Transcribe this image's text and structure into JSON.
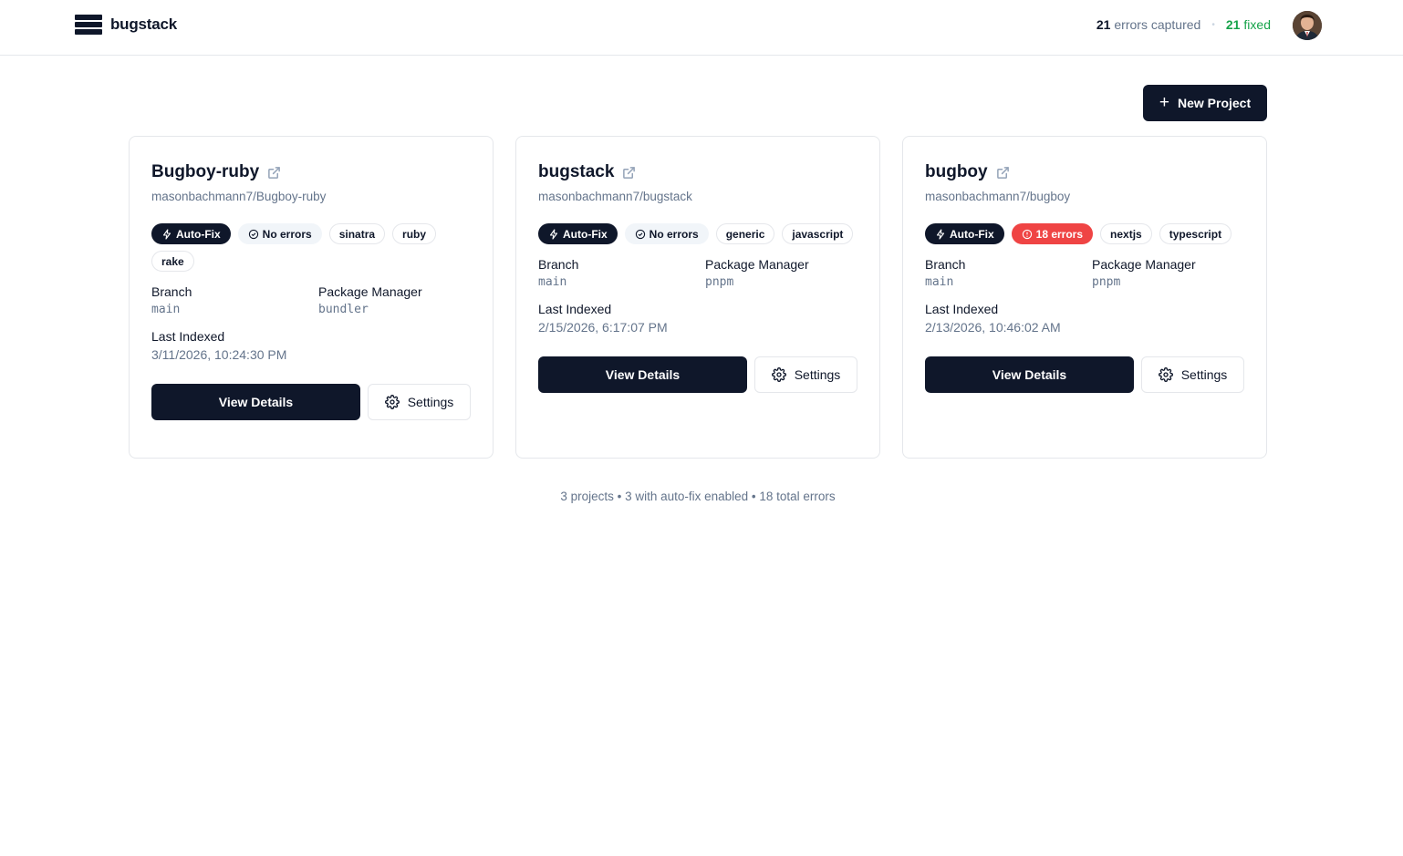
{
  "header": {
    "brand": "bugstack",
    "errors_captured_count": "21",
    "errors_captured_label": "errors captured",
    "separator": "•",
    "fixed_count": "21",
    "fixed_label": "fixed",
    "avatar_icon": "user-avatar"
  },
  "toolbar": {
    "new_project_icon": "plus-icon",
    "new_project_label": "New Project"
  },
  "projects": [
    {
      "name": "Bugboy-ruby",
      "repo": "masonbachmann7/Bugboy-ruby",
      "autofix_label": "Auto-Fix",
      "status_label": "No errors",
      "status_type": "none",
      "tags": [
        "sinatra",
        "ruby",
        "rake"
      ],
      "branch_label": "Branch",
      "branch": "main",
      "pm_label": "Package Manager",
      "package_manager": "bundler",
      "indexed_label": "Last Indexed",
      "last_indexed": "3/11/2026, 10:24:30 PM",
      "view_label": "View Details",
      "settings_label": "Settings"
    },
    {
      "name": "bugstack",
      "repo": "masonbachmann7/bugstack",
      "autofix_label": "Auto-Fix",
      "status_label": "No errors",
      "status_type": "none",
      "tags": [
        "generic",
        "javascript"
      ],
      "branch_label": "Branch",
      "branch": "main",
      "pm_label": "Package Manager",
      "package_manager": "pnpm",
      "indexed_label": "Last Indexed",
      "last_indexed": "2/15/2026, 6:17:07 PM",
      "view_label": "View Details",
      "settings_label": "Settings"
    },
    {
      "name": "bugboy",
      "repo": "masonbachmann7/bugboy",
      "autofix_label": "Auto-Fix",
      "status_label": "18 errors",
      "status_type": "error",
      "tags": [
        "nextjs",
        "typescript"
      ],
      "branch_label": "Branch",
      "branch": "main",
      "pm_label": "Package Manager",
      "package_manager": "pnpm",
      "indexed_label": "Last Indexed",
      "last_indexed": "2/13/2026, 10:46:02 AM",
      "view_label": "View Details",
      "settings_label": "Settings"
    }
  ],
  "footer": {
    "summary": "3 projects • 3 with auto-fix enabled • 18 total errors"
  },
  "colors": {
    "primary": "#0f172a",
    "muted_text": "#64748b",
    "success": "#16a34a",
    "error": "#ef4444",
    "border": "#e5e7eb"
  }
}
